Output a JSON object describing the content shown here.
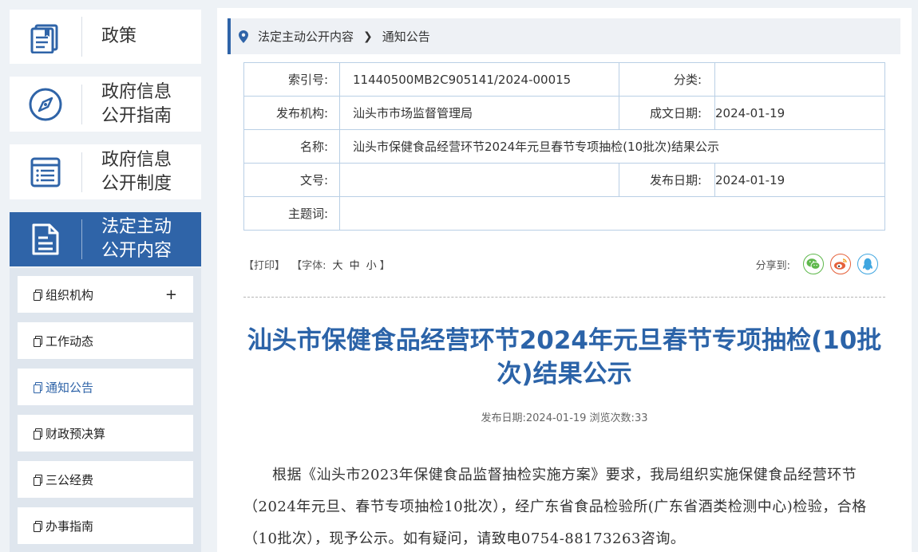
{
  "sidebar": {
    "cards": [
      {
        "label": "政策",
        "icon": "book-icon"
      },
      {
        "label": "政府信息\n公开指南",
        "icon": "compass-icon"
      },
      {
        "label": "政府信息\n公开制度",
        "icon": "list-document-icon"
      },
      {
        "label": "法定主动\n公开内容",
        "icon": "document-icon"
      }
    ],
    "submenu": [
      {
        "label": "组织机构",
        "expand": "+"
      },
      {
        "label": "工作动态"
      },
      {
        "label": "通知公告"
      },
      {
        "label": "财政预决算"
      },
      {
        "label": "三公经费"
      },
      {
        "label": "办事指南"
      }
    ]
  },
  "breadcrumb": {
    "items": [
      "法定主动公开内容",
      "通知公告"
    ]
  },
  "meta": {
    "index_label": "索引号:",
    "index_value": "11440500MB2C905141/2024-00015",
    "category_label": "分类:",
    "category_value": "",
    "publisher_label": "发布机构:",
    "publisher_value": "汕头市市场监督管理局",
    "written_date_label": "成文日期:",
    "written_date_value": "2024-01-19",
    "name_label": "名称:",
    "name_value": "汕头市保健食品经营环节2024年元旦春节专项抽检(10批次)结果公示",
    "doc_no_label": "文号:",
    "doc_no_value": "",
    "publish_date_label": "发布日期:",
    "publish_date_value": "2024-01-19",
    "subject_label": "主题词:",
    "subject_value": ""
  },
  "tools": {
    "print": "【打印】",
    "font_prefix": "【字体:",
    "font_large": "大",
    "font_medium": "中",
    "font_small": "小",
    "font_suffix": "】",
    "share_label": "分享到:"
  },
  "article": {
    "title": "汕头市保健食品经营环节2024年元旦春节专项抽检(10批次)结果公示",
    "pubinfo": "发布日期:2024-01-19  浏览次数:33",
    "body": "根据《汕头市2023年保健食品监督抽检实施方案》要求，我局组织实施保健食品经营环节（2024年元旦、春节专项抽检10批次），经广东省食品检验所(广东省酒类检测中心)检验，合格（10批次），现予公示。如有疑问，请致电0754-88173263咨询。"
  },
  "colors": {
    "brand": "#2f64a8",
    "title": "#2b63a8",
    "wechat": "#5fb84c",
    "weibo": "#e5613a",
    "qq": "#3fa6e0"
  }
}
